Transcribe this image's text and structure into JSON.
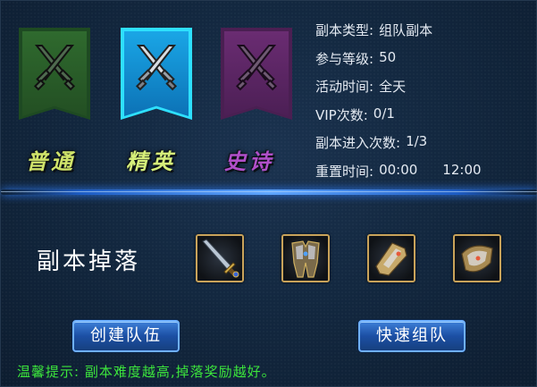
{
  "difficulties": [
    {
      "label": "普通",
      "color": "#cfe36a",
      "banner_color": "#2f6a2e"
    },
    {
      "label": "精英",
      "color": "#d6ef7a",
      "banner_color": "#1aa6e6",
      "selected": true
    },
    {
      "label": "史诗",
      "color": "#b04fc9",
      "banner_color": "#6a2c72"
    }
  ],
  "info": {
    "type_key": "副本类型:",
    "type_val": "组队副本",
    "level_key": "参与等级:",
    "level_val": "50",
    "time_key": "活动时间:",
    "time_val": "全天",
    "vip_key": "VIP次数:",
    "vip_val": "0/1",
    "entry_key": "副本进入次数:",
    "entry_val": "1/3",
    "reset_key": "重置时间:",
    "reset_val1": "00:00",
    "reset_val2": "12:00"
  },
  "drops": {
    "label": "副本掉落",
    "items": [
      "sword-item-icon",
      "armor-item-icon",
      "gauntlet-item-icon",
      "shoulder-item-icon"
    ]
  },
  "buttons": {
    "create": "创建队伍",
    "quick": "快速组队"
  },
  "tip": "温馨提示: 副本难度越高,掉落奖励越好。"
}
